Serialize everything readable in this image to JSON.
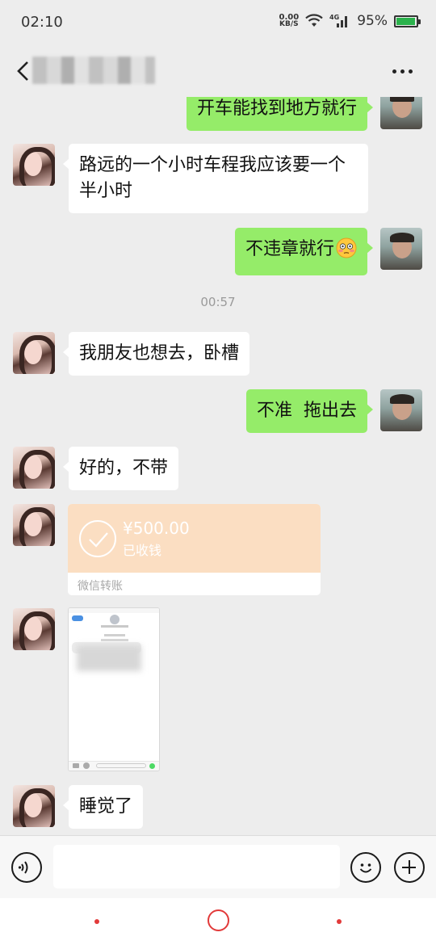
{
  "status_bar": {
    "time": "02:10",
    "net_speed_value": "0.00",
    "net_speed_unit": "KB/S",
    "network": "4G",
    "battery": "95%"
  },
  "header": {
    "contact_name": ""
  },
  "messages": [
    {
      "from": "me",
      "text": "开车能找到地方就行"
    },
    {
      "from": "them",
      "text": "路远的一个小时车程我应该要一个半小时"
    },
    {
      "from": "me",
      "text": "不违章就行"
    },
    {
      "timestamp": "00:57"
    },
    {
      "from": "them",
      "text": "我朋友也想去，卧槽"
    },
    {
      "from": "me",
      "text": "不准  拖出去"
    },
    {
      "from": "them",
      "text": "好的，不带"
    },
    {
      "from": "them",
      "type": "transfer",
      "amount": "¥500.00",
      "status": "已收钱",
      "footer": "微信转账"
    },
    {
      "from": "them",
      "type": "image"
    },
    {
      "from": "them",
      "text": "睡觉了"
    }
  ],
  "input_bar": {
    "placeholder": ""
  },
  "colors": {
    "outgoing_bubble": "#95ec69",
    "incoming_bubble": "#ffffff",
    "transfer_card": "#fbdec2",
    "nav_accent": "#e23a3a"
  }
}
